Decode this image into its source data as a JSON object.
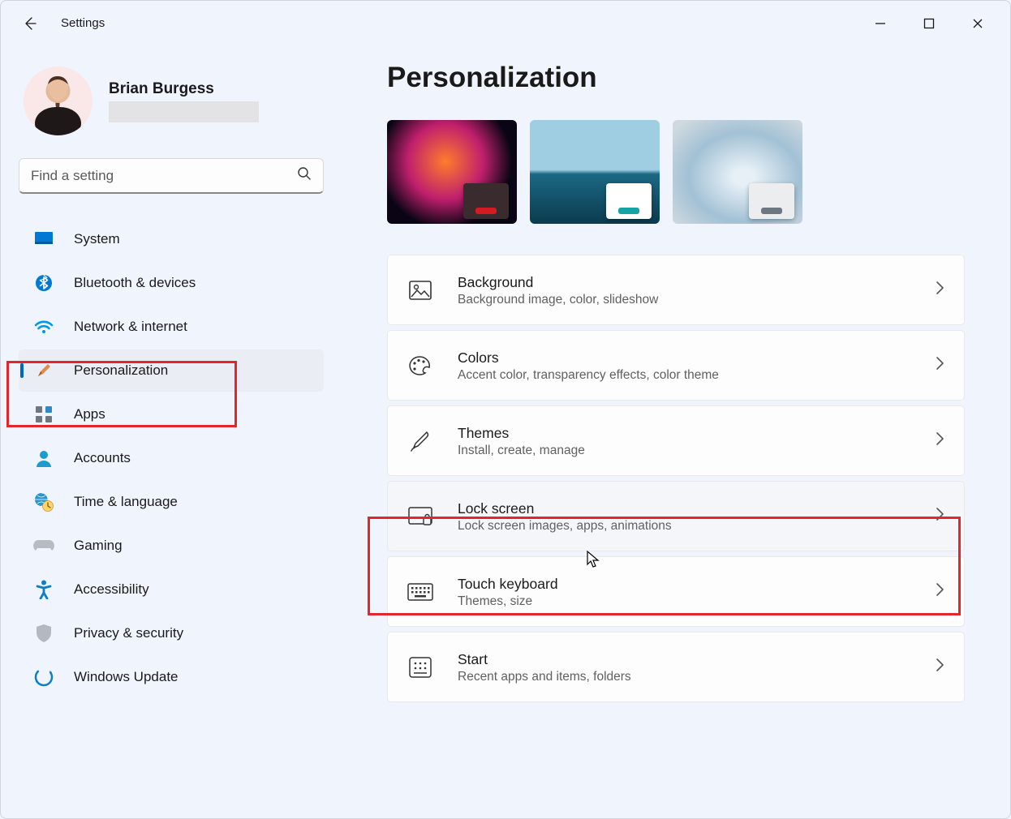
{
  "window": {
    "title": "Settings",
    "minimize": "–",
    "maximize": "▢",
    "close": "✕"
  },
  "user": {
    "name": "Brian Burgess"
  },
  "search": {
    "placeholder": "Find a setting"
  },
  "nav": {
    "system": "System",
    "bluetooth": "Bluetooth & devices",
    "network": "Network & internet",
    "personalization": "Personalization",
    "apps": "Apps",
    "accounts": "Accounts",
    "time": "Time & language",
    "gaming": "Gaming",
    "accessibility": "Accessibility",
    "privacy": "Privacy & security",
    "update": "Windows Update"
  },
  "page": {
    "title": "Personalization"
  },
  "cards": {
    "background": {
      "title": "Background",
      "desc": "Background image, color, slideshow"
    },
    "colors": {
      "title": "Colors",
      "desc": "Accent color, transparency effects, color theme"
    },
    "themes": {
      "title": "Themes",
      "desc": "Install, create, manage"
    },
    "lock": {
      "title": "Lock screen",
      "desc": "Lock screen images, apps, animations"
    },
    "touch": {
      "title": "Touch keyboard",
      "desc": "Themes, size"
    },
    "start": {
      "title": "Start",
      "desc": "Recent apps and items, folders"
    }
  }
}
